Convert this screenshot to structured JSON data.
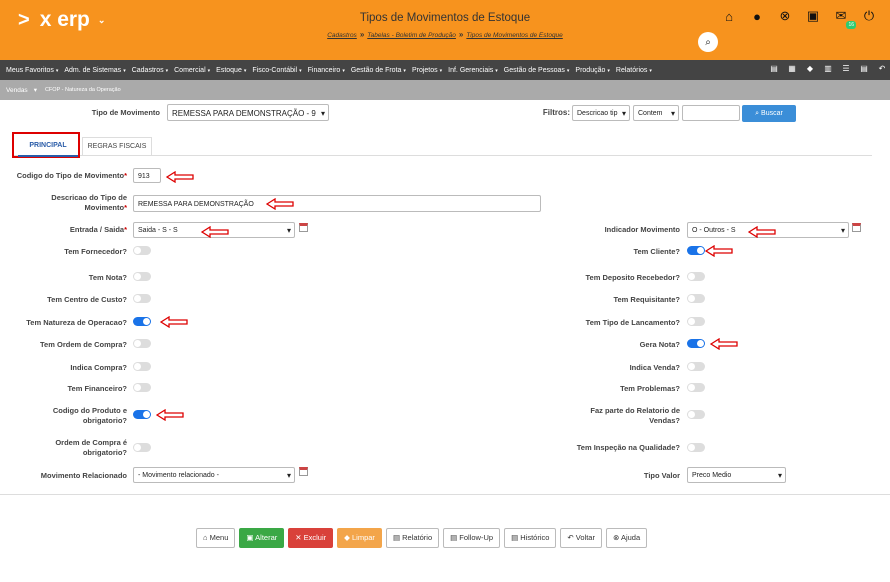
{
  "header": {
    "logo": "x erp",
    "title": "Tipos de Movimentos de Estoque",
    "breadcrumb": [
      "Cadastros",
      "Tabelas - Boletim de Produção",
      "Tipos de Movimentos de Estoque"
    ],
    "notification_count": "16"
  },
  "menu": {
    "items": [
      "Meus Favoritos",
      "Adm. de Sistemas",
      "Cadastros",
      "Comercial",
      "Estoque",
      "Fisco-Contábil",
      "Financeiro",
      "Gestão de Frota",
      "Projetos",
      "Inf. Gerenciais",
      "Gestão de Pessoas",
      "Produção",
      "Relatórios"
    ]
  },
  "subbar": {
    "module": "Vendas",
    "item": "CFOP - Natureza da Operação"
  },
  "top": {
    "tipo_label": "Tipo de Movimento",
    "tipo_value": "REMESSA PARA DEMONSTRAÇÃO - 9",
    "filtros_label": "Filtros:",
    "filtro1": "Descricao tip",
    "filtro2": "Contem",
    "buscar": "Buscar"
  },
  "tabs": {
    "principal": "PRINCIPAL",
    "regras": "REGRAS FISCAIS"
  },
  "form": {
    "codigo_label": "Codigo do Tipo de Movimento",
    "codigo_value": "913",
    "descricao_label_1": "Descricao do Tipo de",
    "descricao_label_2": "Movimento",
    "descricao_value": "REMESSA PARA DEMONSTRAÇÃO",
    "entrada_label": "Entrada / Saida",
    "entrada_value": "Saida - S - S",
    "indicador_label": "Indicador Movimento",
    "indicador_value": "O - Outros - S",
    "left_toggles": [
      {
        "label": "Tem Fornecedor?",
        "on": false
      },
      {
        "label": "Tem Nota?",
        "on": false
      },
      {
        "label": "Tem Centro de Custo?",
        "on": false
      },
      {
        "label": "Tem Natureza de Operacao?",
        "on": true
      },
      {
        "label": "Tem Ordem de Compra?",
        "on": false
      },
      {
        "label": "Indica Compra?",
        "on": false
      },
      {
        "label": "Tem Financeiro?",
        "on": false
      }
    ],
    "right_toggles": [
      {
        "label": "Tem Cliente?",
        "on": true
      },
      {
        "label": "Tem Deposito Recebedor?",
        "on": false
      },
      {
        "label": "Tem Requisitante?",
        "on": false
      },
      {
        "label": "Tem Tipo de Lancamento?",
        "on": false
      },
      {
        "label": "Gera Nota?",
        "on": true
      },
      {
        "label": "Indica Venda?",
        "on": false
      },
      {
        "label": "Tem Problemas?",
        "on": false
      }
    ],
    "codigo_produto_1": "Codigo do Produto e",
    "codigo_produto_2": "obrigatorio?",
    "ordem_compra_1": "Ordem de Compra é",
    "ordem_compra_2": "obrigatorio?",
    "relatorio_1": "Faz parte do Relatorio de",
    "relatorio_2": "Vendas?",
    "inspecao": "Tem Inspeção na Qualidade?",
    "mov_rel_label": "Movimento Relacionado",
    "mov_rel_value": "- Movimento relacionado -",
    "tipo_valor_label": "Tipo Valor",
    "tipo_valor_value": "Preco Medio"
  },
  "buttons": {
    "menu": "Menu",
    "alterar": "Alterar",
    "excluir": "Excluir",
    "limpar": "Limpar",
    "relatorio": "Relatório",
    "followup": "Follow-Up",
    "historico": "Histórico",
    "voltar": "Voltar",
    "ajuda": "Ajuda"
  }
}
